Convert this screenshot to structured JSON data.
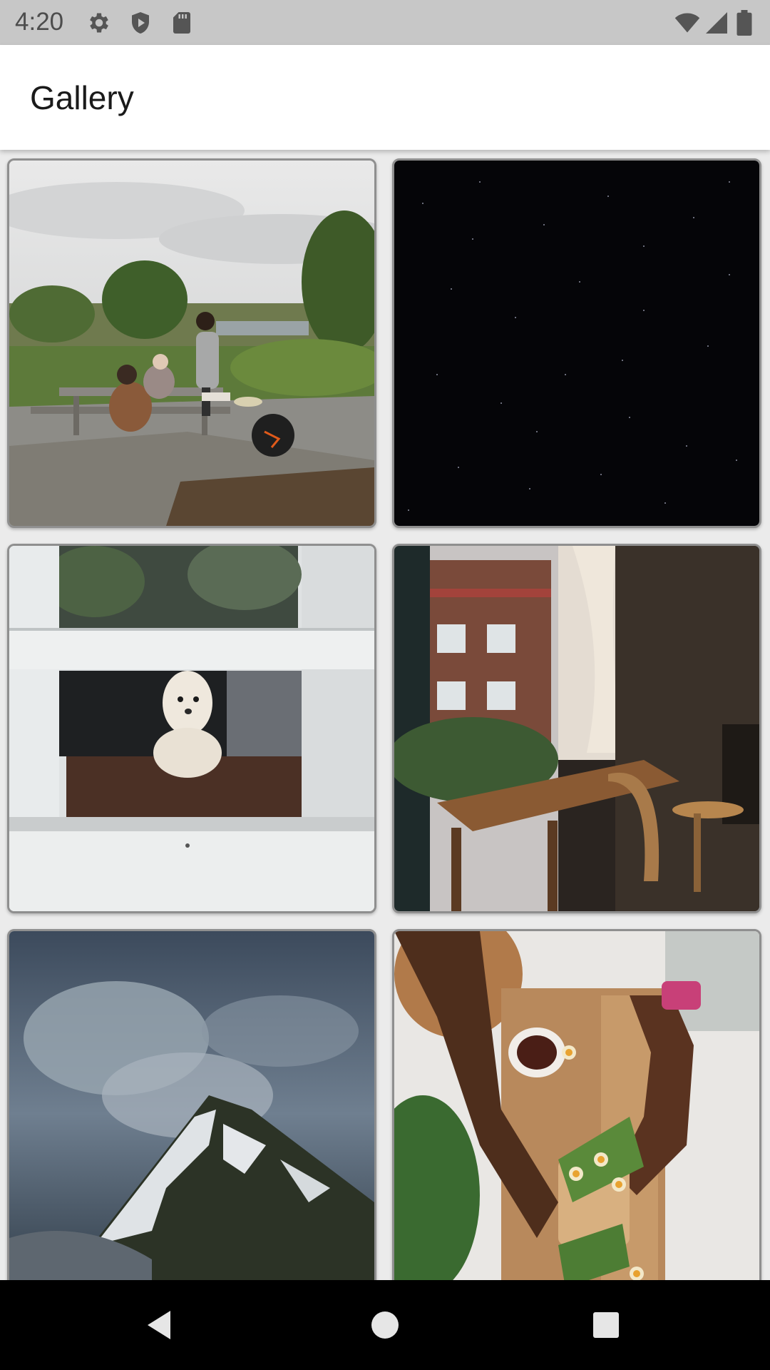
{
  "status_bar": {
    "time": "4:20",
    "left_icons": [
      "gear-icon",
      "shield-icon",
      "sd-card-icon"
    ],
    "right_icons": [
      "wifi-icon",
      "signal-icon",
      "battery-icon"
    ]
  },
  "app_bar": {
    "title": "Gallery"
  },
  "gallery": {
    "items": [
      {
        "subject": "picnic-table-landscape"
      },
      {
        "subject": "night-sky-stars"
      },
      {
        "subject": "dog-behind-window"
      },
      {
        "subject": "dining-table-by-window"
      },
      {
        "subject": "cloudy-snowy-mountain"
      },
      {
        "subject": "hands-preparing-food"
      }
    ]
  },
  "nav_bar": {
    "buttons": [
      "back-icon",
      "home-icon",
      "recents-icon"
    ]
  },
  "colors": {
    "status_bar_bg": "#c7c7c7",
    "app_bar_bg": "#ffffff",
    "content_bg": "#ebebeb",
    "tile_border": "#8f8f8f",
    "nav_bar_bg": "#000000"
  }
}
